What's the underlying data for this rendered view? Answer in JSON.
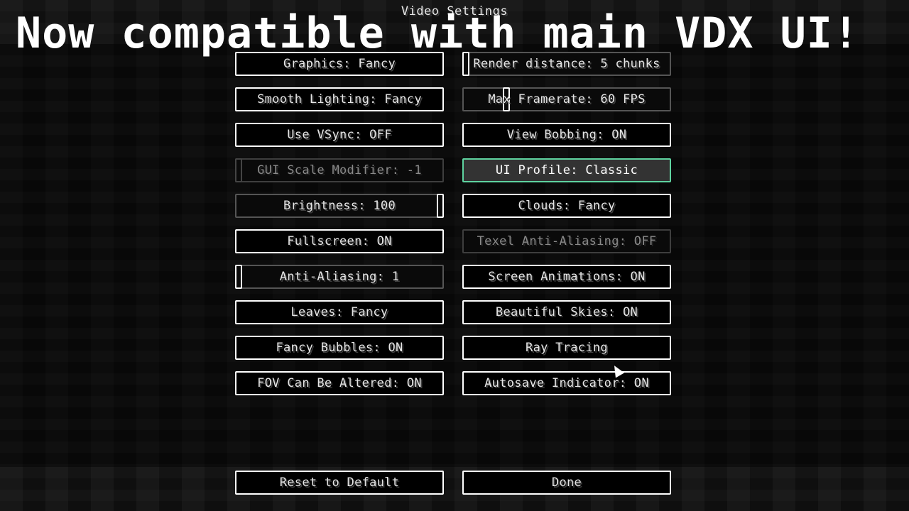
{
  "screen": {
    "title": "Video Settings"
  },
  "banner": {
    "text": "Now compatible with main VDX UI!"
  },
  "options": [
    {
      "label": "Graphics: Fancy",
      "type": "button",
      "state": "normal"
    },
    {
      "label": "Render distance: 5 chunks",
      "type": "slider",
      "state": "normal",
      "value_fraction": 0.0
    },
    {
      "label": "Smooth Lighting: Fancy",
      "type": "button",
      "state": "normal"
    },
    {
      "label": "Max Framerate: 60 FPS",
      "type": "slider",
      "state": "normal",
      "value_fraction": 0.2
    },
    {
      "label": "Use VSync: OFF",
      "type": "button",
      "state": "normal"
    },
    {
      "label": "View Bobbing: ON",
      "type": "button",
      "state": "normal"
    },
    {
      "label": "GUI Scale Modifier: -1",
      "type": "slider",
      "state": "disabled",
      "value_fraction": 0.0
    },
    {
      "label": "UI Profile: Classic",
      "type": "button",
      "state": "focused"
    },
    {
      "label": "Brightness: 100",
      "type": "slider",
      "state": "normal",
      "value_fraction": 1.0
    },
    {
      "label": "Clouds: Fancy",
      "type": "button",
      "state": "normal"
    },
    {
      "label": "Fullscreen: ON",
      "type": "button",
      "state": "normal"
    },
    {
      "label": "Texel Anti-Aliasing: OFF",
      "type": "button",
      "state": "disabled"
    },
    {
      "label": "Anti-Aliasing: 1",
      "type": "slider",
      "state": "normal",
      "value_fraction": 0.0
    },
    {
      "label": "Screen Animations: ON",
      "type": "button",
      "state": "normal"
    },
    {
      "label": "Leaves: Fancy",
      "type": "button",
      "state": "normal"
    },
    {
      "label": "Beautiful Skies: ON",
      "type": "button",
      "state": "normal"
    },
    {
      "label": "Fancy Bubbles: ON",
      "type": "button",
      "state": "normal"
    },
    {
      "label": "Ray Tracing",
      "type": "button",
      "state": "normal"
    },
    {
      "label": "FOV Can Be Altered: ON",
      "type": "button",
      "state": "normal"
    },
    {
      "label": "Autosave Indicator: ON",
      "type": "button",
      "state": "normal"
    }
  ],
  "footer": {
    "reset_label": "Reset to Default",
    "done_label": "Done"
  },
  "colors": {
    "focus_border": "#5fd3a0",
    "button_border": "#ffffff",
    "disabled_text": "#8a8a8a"
  }
}
